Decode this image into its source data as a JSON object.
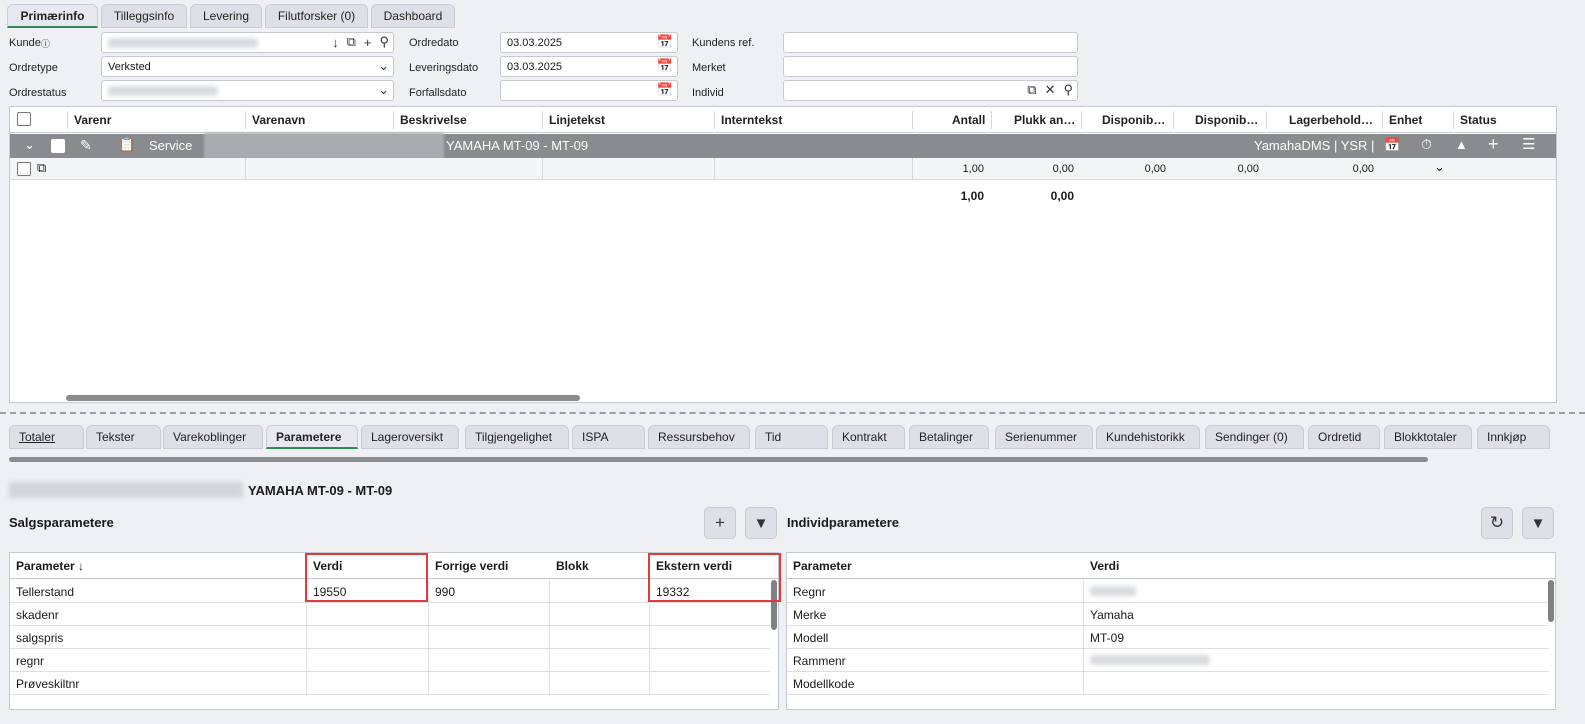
{
  "top_tabs": [
    {
      "label": "Primærinfo",
      "active": true
    },
    {
      "label": "Tilleggsinfo"
    },
    {
      "label": "Levering"
    },
    {
      "label": "Filutforsker (0)"
    },
    {
      "label": "Dashboard"
    }
  ],
  "form": {
    "kunde_label": "Kunde",
    "ordretype_label": "Ordretype",
    "ordretype_value": "Verksted",
    "ordrestatus_label": "Ordrestatus",
    "ordredato_label": "Ordredato",
    "ordredato_value": "03.03.2025",
    "leveringsdato_label": "Leveringsdato",
    "leveringsdato_value": "03.03.2025",
    "forfallsdato_label": "Forfallsdato",
    "forfallsdato_value": "",
    "kundens_ref_label": "Kundens ref.",
    "merket_label": "Merket",
    "individ_label": "Individ"
  },
  "grid": {
    "headers": [
      "Varenr",
      "Varenavn",
      "Beskrivelse",
      "Linjetekst",
      "Interntekst",
      "Antall",
      "Plukk an…",
      "Disponib…",
      "Disponib…",
      "Lagerbehold…",
      "Enhet",
      "Status"
    ],
    "group": {
      "label": "Service",
      "title": "YAMAHA MT-09 - MT-09",
      "right": "YamahaDMS | YSR |"
    },
    "row": {
      "antall": "1,00",
      "plukk": "0,00",
      "disp1": "0,00",
      "disp2": "0,00",
      "lager": "0,00"
    },
    "totals": {
      "antall": "1,00",
      "plukk": "0,00"
    }
  },
  "bottom_tabs": [
    "Totaler",
    "Tekster",
    "Varekoblinger",
    "Parametere",
    "Lageroversikt",
    "Tilgjengelighet",
    "ISPA",
    "Ressursbehov",
    "Tid",
    "Kontrakt",
    "Betalinger",
    "Serienummer",
    "Kundehistorikk",
    "Sendinger (0)",
    "Ordretid",
    "Blokktotaler",
    "Innkjøp"
  ],
  "active_bottom_tab": "Parametere",
  "section_title": "YAMAHA MT-09 - MT-09",
  "salgsparametere": {
    "title": "Salgsparametere",
    "headers": [
      "Parameter ↓",
      "Verdi",
      "Forrige verdi",
      "Blokk",
      "Ekstern verdi"
    ],
    "rows": [
      [
        "Tellerstand",
        "19550",
        "990",
        "",
        "19332"
      ],
      [
        "skadenr",
        "",
        "",
        "",
        ""
      ],
      [
        "salgspris",
        "",
        "",
        "",
        ""
      ],
      [
        "regnr",
        "",
        "",
        "",
        ""
      ],
      [
        "Prøveskiltnr",
        "",
        "",
        "",
        ""
      ]
    ]
  },
  "individparametere": {
    "title": "Individparametere",
    "headers": [
      "Parameter",
      "Verdi"
    ],
    "rows": [
      [
        "Regnr",
        ""
      ],
      [
        "Merke",
        "Yamaha"
      ],
      [
        "Modell",
        "MT-09"
      ],
      [
        "Rammenr",
        ""
      ],
      [
        "Modellkode",
        ""
      ]
    ]
  },
  "colors": {
    "accent": "#2e8b57",
    "highlight": "#e23b3b",
    "group_bar": "#898b8e"
  }
}
